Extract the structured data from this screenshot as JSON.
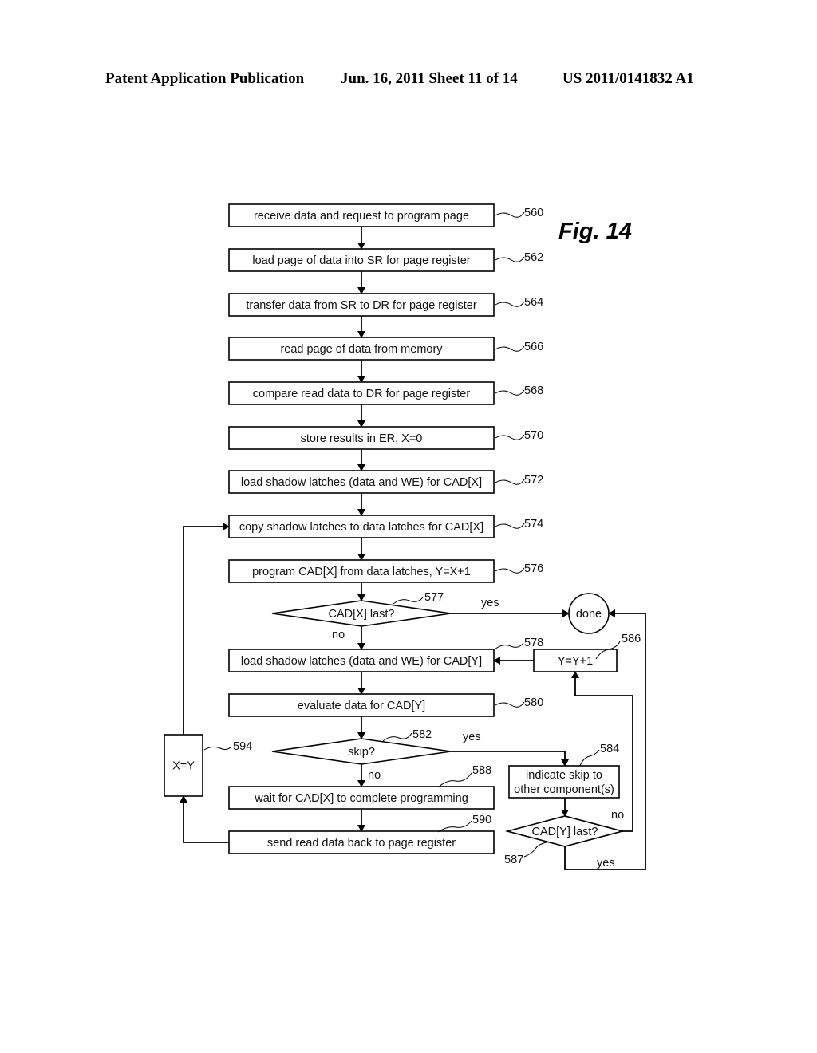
{
  "header": {
    "left": "Patent Application Publication",
    "middle": "Jun. 16, 2011  Sheet 11 of 14",
    "right": "US 2011/0141832 A1"
  },
  "figure": {
    "title": "Fig. 14"
  },
  "nodes": [
    {
      "id": "560",
      "type": "process",
      "text": [
        "receive data and request to program page"
      ]
    },
    {
      "id": "562",
      "type": "process",
      "text": [
        "load page of data into SR for page register"
      ]
    },
    {
      "id": "564",
      "type": "process",
      "text": [
        "transfer data from SR to DR for page register"
      ]
    },
    {
      "id": "566",
      "type": "process",
      "text": [
        "read page of data from memory"
      ]
    },
    {
      "id": "568",
      "type": "process",
      "text": [
        "compare read data to DR for page register"
      ]
    },
    {
      "id": "570",
      "type": "process",
      "text": [
        "store results in ER, X=0"
      ]
    },
    {
      "id": "572",
      "type": "process",
      "text": [
        "load shadow latches (data and WE) for CAD[X]"
      ]
    },
    {
      "id": "574",
      "type": "process",
      "text": [
        "copy shadow latches to data latches for CAD[X]"
      ]
    },
    {
      "id": "576",
      "type": "process",
      "text": [
        "program CAD[X] from data latches, Y=X+1"
      ]
    },
    {
      "id": "577",
      "type": "decision",
      "text": [
        "CAD[X] last?"
      ]
    },
    {
      "id": "done",
      "type": "terminal",
      "text": [
        "done"
      ]
    },
    {
      "id": "578",
      "type": "process",
      "text": [
        "load shadow latches (data and WE) for CAD[Y]"
      ]
    },
    {
      "id": "586",
      "type": "process",
      "text": [
        "Y=Y+1"
      ]
    },
    {
      "id": "580",
      "type": "process",
      "text": [
        "evaluate data for CAD[Y]"
      ]
    },
    {
      "id": "582",
      "type": "decision",
      "text": [
        "skip?"
      ]
    },
    {
      "id": "584",
      "type": "process",
      "text": [
        "indicate skip to",
        "other component(s)"
      ]
    },
    {
      "id": "588",
      "type": "process",
      "text": [
        "wait for CAD[X] to complete programming"
      ]
    },
    {
      "id": "587",
      "type": "decision",
      "text": [
        "CAD[Y] last?"
      ]
    },
    {
      "id": "590",
      "type": "process",
      "text": [
        "send read data back to page register"
      ]
    },
    {
      "id": "594",
      "type": "process",
      "text": [
        "X=Y"
      ]
    }
  ],
  "edges": [
    {
      "from": "560",
      "to": "562",
      "label": ""
    },
    {
      "from": "562",
      "to": "564",
      "label": ""
    },
    {
      "from": "564",
      "to": "566",
      "label": ""
    },
    {
      "from": "566",
      "to": "568",
      "label": ""
    },
    {
      "from": "568",
      "to": "570",
      "label": ""
    },
    {
      "from": "570",
      "to": "572",
      "label": ""
    },
    {
      "from": "572",
      "to": "574",
      "label": ""
    },
    {
      "from": "574",
      "to": "576",
      "label": ""
    },
    {
      "from": "576",
      "to": "577",
      "label": ""
    },
    {
      "from": "577",
      "to": "done",
      "label": "yes"
    },
    {
      "from": "577",
      "to": "578",
      "label": "no"
    },
    {
      "from": "578",
      "to": "580",
      "label": ""
    },
    {
      "from": "580",
      "to": "582",
      "label": ""
    },
    {
      "from": "582",
      "to": "584",
      "label": "yes"
    },
    {
      "from": "582",
      "to": "588",
      "label": "no"
    },
    {
      "from": "584",
      "to": "587",
      "label": ""
    },
    {
      "from": "587",
      "to": "586",
      "label": "no"
    },
    {
      "from": "587",
      "to": "done",
      "label": "yes"
    },
    {
      "from": "586",
      "to": "578",
      "label": ""
    },
    {
      "from": "588",
      "to": "590",
      "label": ""
    },
    {
      "from": "590",
      "to": "594",
      "label": ""
    },
    {
      "from": "594",
      "to": "574",
      "label": ""
    }
  ]
}
